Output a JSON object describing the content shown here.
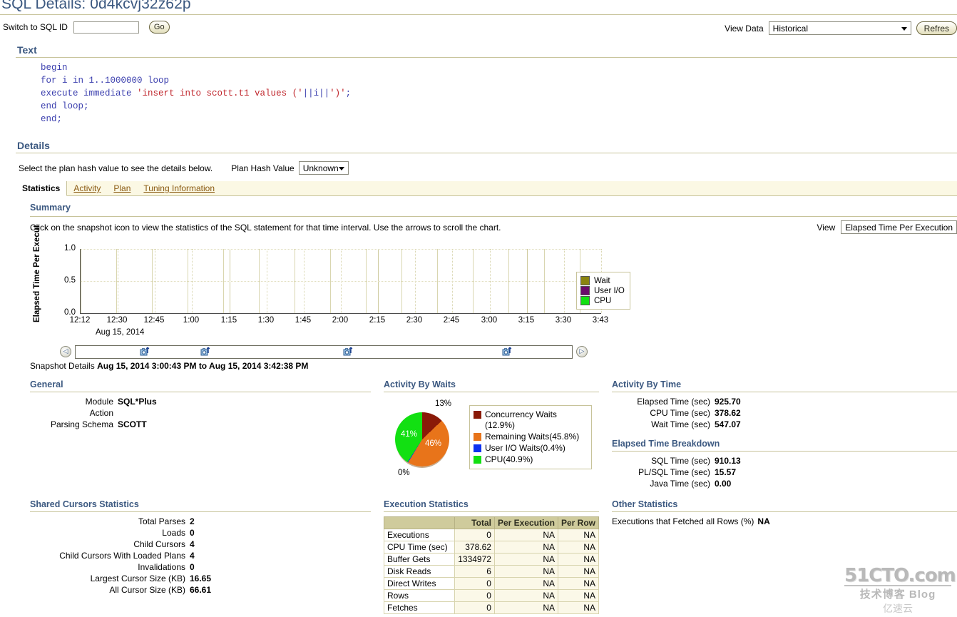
{
  "page": {
    "title": "SQL Details: 0d4kcvj32z62p"
  },
  "toolbar": {
    "switch_label": "Switch to SQL ID",
    "sqlid_value": "",
    "go_label": "Go",
    "view_data_label": "View Data",
    "view_data_value": "Historical",
    "refresh_label": "Refres"
  },
  "text_section": {
    "heading": "Text",
    "sql_lines": [
      {
        "parts": [
          {
            "t": "begin",
            "c": "k"
          }
        ]
      },
      {
        "parts": [
          {
            "t": "for i in 1..1000000 loop",
            "c": "k"
          }
        ]
      },
      {
        "parts": [
          {
            "t": "execute immediate ",
            "c": "k"
          },
          {
            "t": "'insert into scott.t1 values ('",
            "c": "s"
          },
          {
            "t": "||i||",
            "c": "k"
          },
          {
            "t": "')'",
            "c": "s"
          },
          {
            "t": ";",
            "c": "k"
          }
        ]
      },
      {
        "parts": [
          {
            "t": "end loop;",
            "c": "k"
          }
        ]
      },
      {
        "parts": [
          {
            "t": "end;",
            "c": "k"
          }
        ]
      }
    ]
  },
  "details_section": {
    "heading": "Details",
    "instruction": "Select the plan hash value to see the details below.",
    "plan_hash_label": "Plan Hash Value",
    "plan_hash_value": "Unknown"
  },
  "tabs": [
    {
      "label": "Statistics",
      "active": true
    },
    {
      "label": "Activity",
      "active": false
    },
    {
      "label": "Plan",
      "active": false
    },
    {
      "label": "Tuning Information",
      "active": false
    }
  ],
  "summary": {
    "heading": "Summary",
    "description": "Click on the snapshot icon to view the statistics of the SQL statement for that time interval. Use the arrows to scroll the chart.",
    "view_label": "View",
    "view_value": "Elapsed Time Per Execution",
    "snapshot_details_label": "Snapshot Details",
    "snapshot_details_value": "Aug 15, 2014 3:00:43 PM to Aug 15, 2014 3:42:38 PM"
  },
  "chart_data": {
    "type": "area",
    "title": "",
    "ylabel": "Elapsed Time Per Execut",
    "xlabel": "Aug 15, 2014",
    "ylim": [
      0,
      1.0
    ],
    "yticks": [
      "0.0",
      "0.5",
      "1.0"
    ],
    "xticks": [
      "12:12",
      "12:30",
      "12:45",
      "1:00",
      "1:15",
      "1:30",
      "1:45",
      "2:00",
      "2:15",
      "2:30",
      "2:45",
      "3:00",
      "3:15",
      "3:30",
      "3:43"
    ],
    "grid": true,
    "legend_position": "right",
    "series": [
      {
        "name": "Wait",
        "color": "#8a8410",
        "values": []
      },
      {
        "name": "User I/O",
        "color": "#6b0a6b",
        "values": []
      },
      {
        "name": "CPU",
        "color": "#12e012",
        "values": []
      }
    ]
  },
  "general": {
    "heading": "General",
    "rows": [
      {
        "label": "Module",
        "value": "SQL*Plus"
      },
      {
        "label": "Action",
        "value": ""
      },
      {
        "label": "Parsing Schema",
        "value": "SCOTT"
      }
    ]
  },
  "activity_by_waits": {
    "heading": "Activity By Waits",
    "pie": {
      "type": "pie",
      "labels": [
        "Concurrency Waits",
        "Remaining Waits",
        "User I/O Waits",
        "CPU"
      ],
      "values": [
        12.9,
        45.8,
        0.4,
        40.9
      ],
      "colors": [
        "#8a1a08",
        "#e8741a",
        "#0d31f0",
        "#12e012"
      ],
      "slice_labels": [
        "13%",
        "46%",
        "0%",
        "41%"
      ]
    },
    "legend": [
      {
        "label": "Concurrency Waits (12.9%)",
        "color": "#8a1a08"
      },
      {
        "label": "Remaining Waits(45.8%)",
        "color": "#e8741a"
      },
      {
        "label": "User I/O Waits(0.4%)",
        "color": "#0d31f0"
      },
      {
        "label": "CPU(40.9%)",
        "color": "#12e012"
      }
    ]
  },
  "activity_by_time": {
    "heading": "Activity By Time",
    "rows": [
      {
        "label": "Elapsed Time (sec)",
        "value": "925.70"
      },
      {
        "label": "CPU Time (sec)",
        "value": "378.62"
      },
      {
        "label": "Wait Time (sec)",
        "value": "547.07"
      }
    ]
  },
  "elapsed_time_breakdown": {
    "heading": "Elapsed Time Breakdown",
    "rows": [
      {
        "label": "SQL Time (sec)",
        "value": "910.13"
      },
      {
        "label": "PL/SQL Time (sec)",
        "value": "15.57"
      },
      {
        "label": "Java Time (sec)",
        "value": "0.00"
      }
    ]
  },
  "shared_cursors": {
    "heading": "Shared Cursors Statistics",
    "rows": [
      {
        "label": "Total Parses",
        "value": "2"
      },
      {
        "label": "Loads",
        "value": "0"
      },
      {
        "label": "Child Cursors",
        "value": "4"
      },
      {
        "label": "Child Cursors With Loaded Plans",
        "value": "4"
      },
      {
        "label": "Invalidations",
        "value": "0"
      },
      {
        "label": "Largest Cursor Size (KB)",
        "value": "16.65"
      },
      {
        "label": "All Cursor Size (KB)",
        "value": "66.61"
      }
    ]
  },
  "execution_statistics": {
    "heading": "Execution Statistics",
    "columns": [
      "",
      "Total",
      "Per Execution",
      "Per Row"
    ],
    "rows": [
      {
        "name": "Executions",
        "total": "0",
        "per_execution": "NA",
        "per_row": "NA"
      },
      {
        "name": "CPU Time (sec)",
        "total": "378.62",
        "per_execution": "NA",
        "per_row": "NA"
      },
      {
        "name": "Buffer Gets",
        "total": "1334972",
        "per_execution": "NA",
        "per_row": "NA"
      },
      {
        "name": "Disk Reads",
        "total": "6",
        "per_execution": "NA",
        "per_row": "NA"
      },
      {
        "name": "Direct Writes",
        "total": "0",
        "per_execution": "NA",
        "per_row": "NA"
      },
      {
        "name": "Rows",
        "total": "0",
        "per_execution": "NA",
        "per_row": "NA"
      },
      {
        "name": "Fetches",
        "total": "0",
        "per_execution": "NA",
        "per_row": "NA"
      }
    ]
  },
  "other_statistics": {
    "heading": "Other Statistics",
    "rows": [
      {
        "label": "Executions that Fetched all Rows (%)",
        "value": "NA"
      }
    ]
  },
  "watermark": {
    "line1": "51CTO.com",
    "line2": "技术博客  Blog",
    "line3": "亿速云"
  }
}
